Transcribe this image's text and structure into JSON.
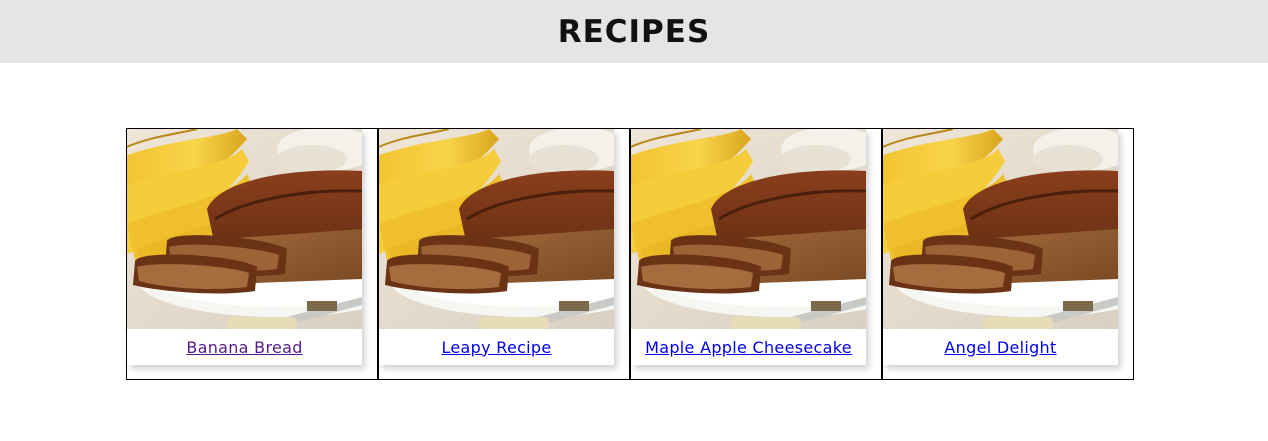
{
  "header": {
    "title": "RECIPES",
    "background": "#e5e5e5"
  },
  "recipes": [
    {
      "name": "Banana Bread",
      "state": "visited",
      "image": "banana-bread-photo"
    },
    {
      "name": "Leapy Recipe",
      "state": "unvisited",
      "image": "banana-bread-photo"
    },
    {
      "name": "Maple Apple Cheesecake",
      "state": "unvisited",
      "image": "banana-bread-photo"
    },
    {
      "name": "Angel Delight",
      "state": "unvisited",
      "image": "banana-bread-photo"
    }
  ],
  "colors": {
    "link": "#0000ee",
    "visited_link": "#551a8b"
  }
}
